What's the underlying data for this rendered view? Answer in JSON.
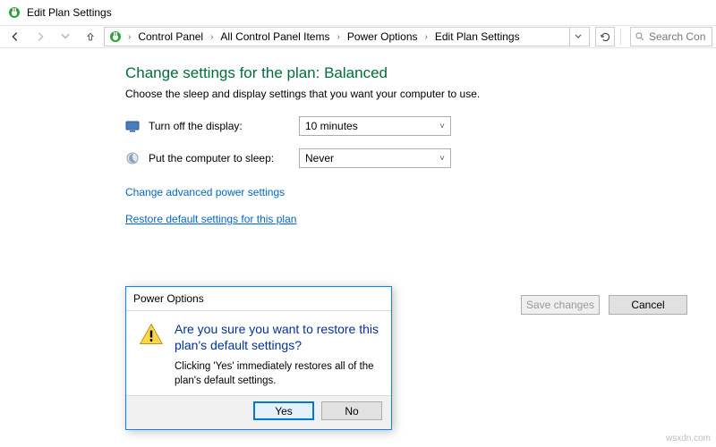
{
  "window": {
    "title": "Edit Plan Settings"
  },
  "breadcrumb": {
    "items": [
      "Control Panel",
      "All Control Panel Items",
      "Power Options",
      "Edit Plan Settings"
    ]
  },
  "search": {
    "placeholder": "Search Con"
  },
  "main": {
    "heading": "Change settings for the plan: Balanced",
    "description": "Choose the sleep and display settings that you want your computer to use.",
    "display_row": {
      "label": "Turn off the display:",
      "value": "10 minutes"
    },
    "sleep_row": {
      "label": "Put the computer to sleep:",
      "value": "Never"
    },
    "advanced_link": "Change advanced power settings",
    "restore_link": "Restore default settings for this plan"
  },
  "footer": {
    "save": "Save changes",
    "cancel": "Cancel"
  },
  "dialog": {
    "title": "Power Options",
    "heading": "Are you sure you want to restore this plan's default settings?",
    "body": "Clicking 'Yes' immediately restores all of the plan's default settings.",
    "yes": "Yes",
    "no": "No"
  },
  "watermark": "wsxdn.com"
}
